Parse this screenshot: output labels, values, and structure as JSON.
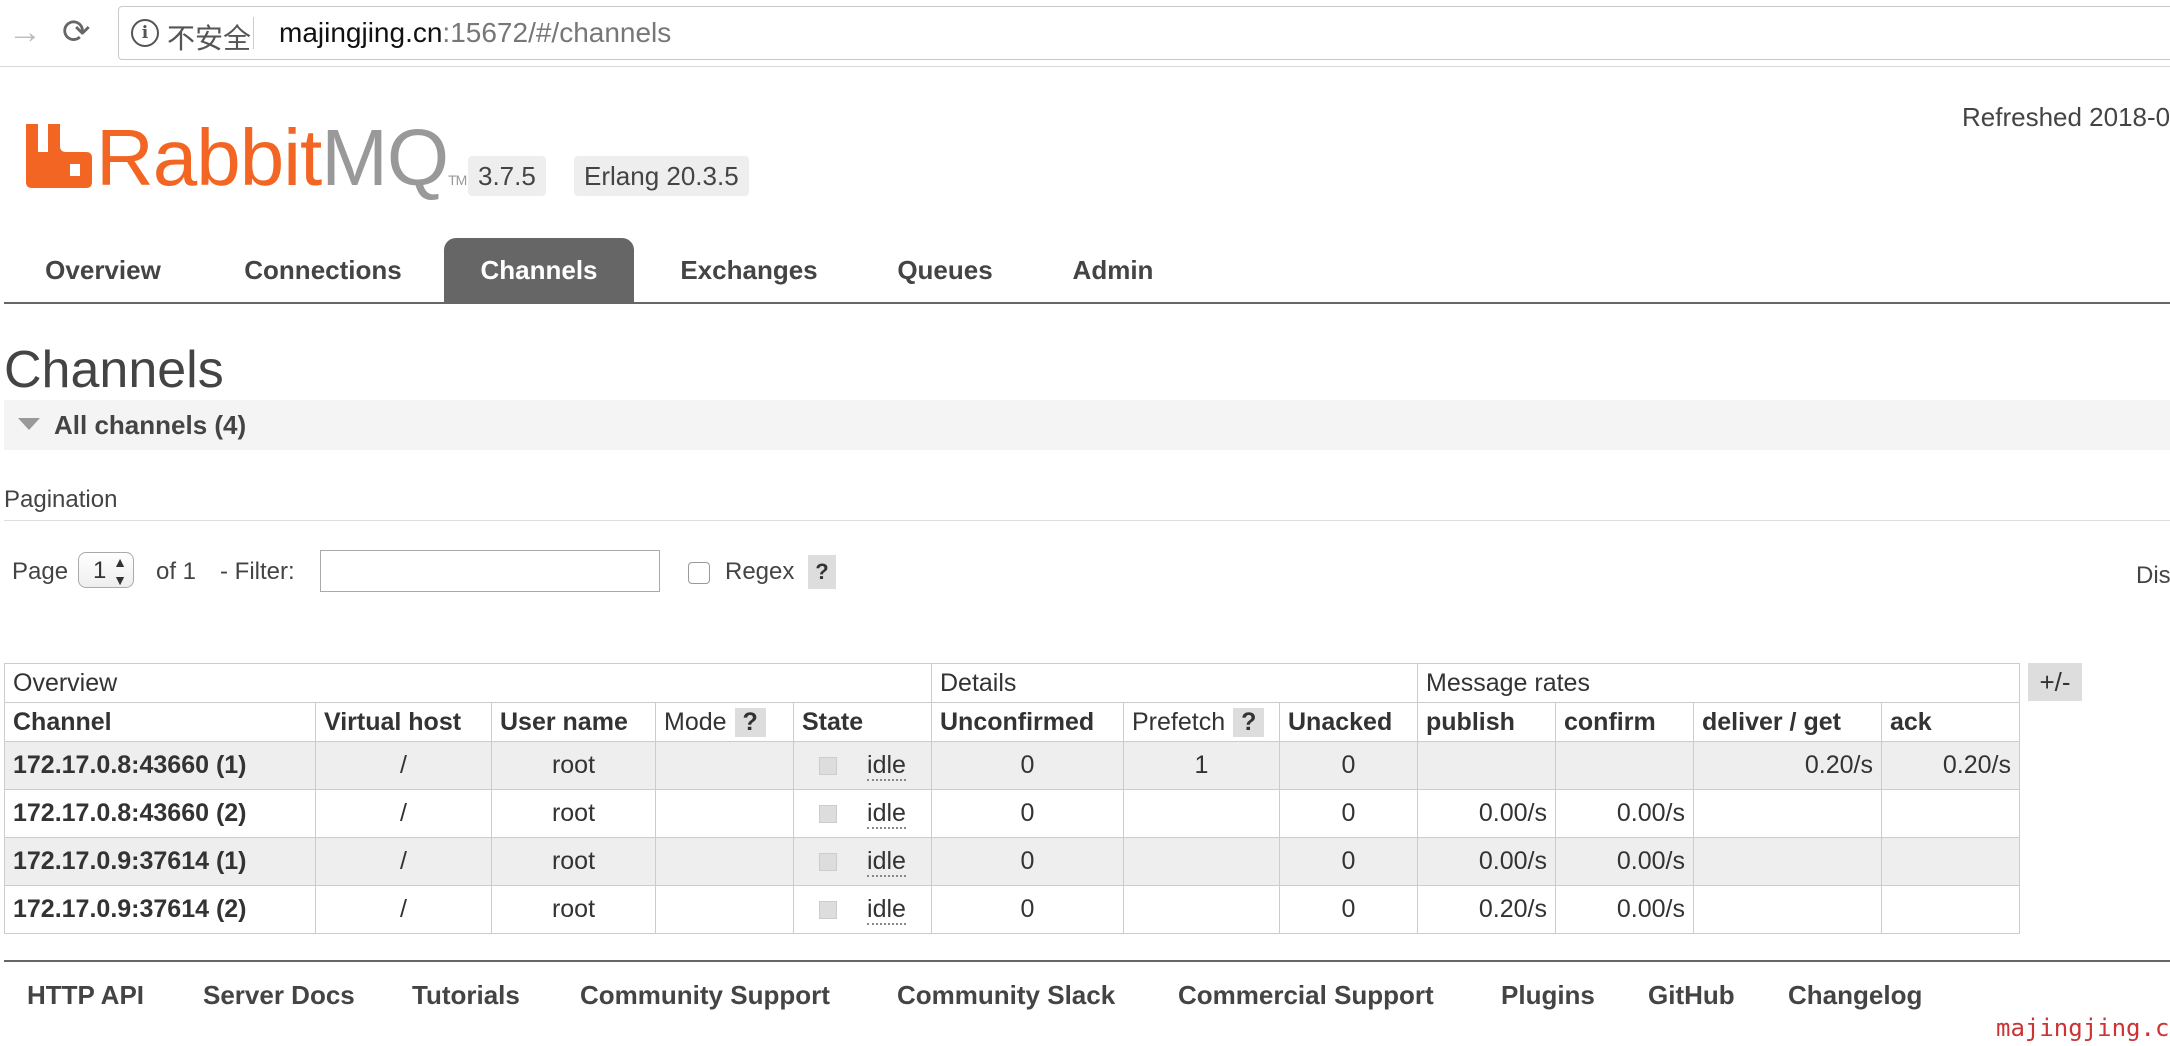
{
  "browser": {
    "security_label": "不安全",
    "url_host": "majingjing.cn",
    "url_rest": ":15672/#/channels"
  },
  "header": {
    "logo_text": "RabbitMQ",
    "logo_primary": "Rabbit",
    "logo_secondary": "MQ",
    "logo_tm": "TM",
    "version": "3.7.5",
    "erlang": "Erlang 20.3.5",
    "refreshed": "Refreshed 2018-0"
  },
  "tabs": [
    {
      "label": "Overview",
      "active": false
    },
    {
      "label": "Connections",
      "active": false
    },
    {
      "label": "Channels",
      "active": true
    },
    {
      "label": "Exchanges",
      "active": false
    },
    {
      "label": "Queues",
      "active": false
    },
    {
      "label": "Admin",
      "active": false
    }
  ],
  "page": {
    "title": "Channels",
    "section_title": "All channels (4)",
    "pagination_label": "Pagination",
    "page_label": "Page",
    "page_value": "1",
    "of_label": "of 1",
    "filter_label": "- Filter:",
    "filter_value": "",
    "regex_label": "Regex",
    "help": "?",
    "display_truncated": "Dis"
  },
  "table": {
    "groups": [
      "Overview",
      "Details",
      "Message rates"
    ],
    "columns": [
      "Channel",
      "Virtual host",
      "User name",
      "Mode",
      "State",
      "Unconfirmed",
      "Prefetch",
      "Unacked",
      "publish",
      "confirm",
      "deliver / get",
      "ack"
    ],
    "toggle_label": "+/-",
    "rows": [
      {
        "channel": "172.17.0.8:43660 (1)",
        "vhost": "/",
        "user": "root",
        "mode": "",
        "state": "idle",
        "unconfirmed": "0",
        "prefetch": "1",
        "unacked": "0",
        "publish": "",
        "confirm": "",
        "deliver_get": "0.20/s",
        "ack": "0.20/s"
      },
      {
        "channel": "172.17.0.8:43660 (2)",
        "vhost": "/",
        "user": "root",
        "mode": "",
        "state": "idle",
        "unconfirmed": "0",
        "prefetch": "",
        "unacked": "0",
        "publish": "0.00/s",
        "confirm": "0.00/s",
        "deliver_get": "",
        "ack": ""
      },
      {
        "channel": "172.17.0.9:37614 (1)",
        "vhost": "/",
        "user": "root",
        "mode": "",
        "state": "idle",
        "unconfirmed": "0",
        "prefetch": "",
        "unacked": "0",
        "publish": "0.00/s",
        "confirm": "0.00/s",
        "deliver_get": "",
        "ack": ""
      },
      {
        "channel": "172.17.0.9:37614 (2)",
        "vhost": "/",
        "user": "root",
        "mode": "",
        "state": "idle",
        "unconfirmed": "0",
        "prefetch": "",
        "unacked": "0",
        "publish": "0.20/s",
        "confirm": "0.00/s",
        "deliver_get": "",
        "ack": ""
      }
    ]
  },
  "footer": {
    "links": [
      "HTTP API",
      "Server Docs",
      "Tutorials",
      "Community Support",
      "Community Slack",
      "Commercial Support",
      "Plugins",
      "GitHub",
      "Changelog"
    ],
    "watermark": "majingjing.cn"
  },
  "colors": {
    "brand_orange": "#f26522",
    "active_tab": "#666666",
    "row_alt": "#eeeeee"
  }
}
